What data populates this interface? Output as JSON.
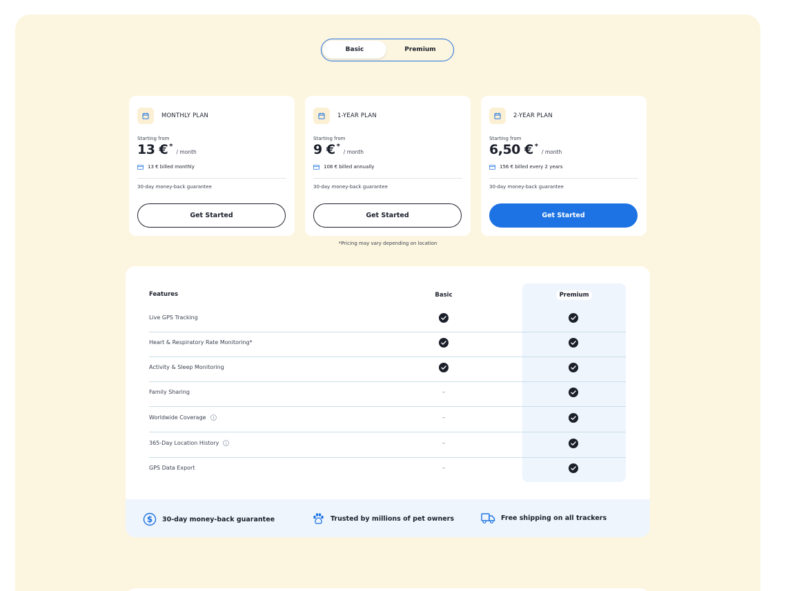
{
  "toggle": {
    "options": [
      "Basic",
      "Premium"
    ],
    "selected": "Basic"
  },
  "plans": [
    {
      "name": "MONTHLY PLAN",
      "starting_label": "Starting from",
      "price": "13 €",
      "star": "*",
      "per": "/ month",
      "billed": "13 € billed monthly",
      "guarantee": "30-day money-back guarantee",
      "cta": "Get Started",
      "primary": false
    },
    {
      "name": "1-YEAR PLAN",
      "starting_label": "Starting from",
      "price": "9 €",
      "star": "*",
      "per": "/ month",
      "billed": "108 € billed annually",
      "guarantee": "30-day money-back guarantee",
      "cta": "Get Started",
      "primary": false
    },
    {
      "name": "2-YEAR PLAN",
      "starting_label": "Starting from",
      "price": "6,50 €",
      "star": "*",
      "per": "/ month",
      "billed": "156 € billed every 2 years",
      "guarantee": "30-day money-back guarantee",
      "cta": "Get Started",
      "primary": true
    }
  ],
  "pricing_note": "*Pricing may vary depending on location",
  "features_table": {
    "headers": {
      "feature": "Features",
      "basic": "Basic",
      "premium": "Premium"
    },
    "rows": [
      {
        "name": "Live GPS Tracking",
        "info": false,
        "basic": true,
        "premium": true
      },
      {
        "name": "Heart & Respiratory Rate Monitoring*",
        "info": false,
        "basic": true,
        "premium": true
      },
      {
        "name": "Activity & Sleep Monitoring",
        "info": false,
        "basic": true,
        "premium": true
      },
      {
        "name": "Family Sharing",
        "info": false,
        "basic": false,
        "premium": true
      },
      {
        "name": "Worldwide Coverage",
        "info": true,
        "basic": false,
        "premium": true
      },
      {
        "name": "365-Day Location History",
        "info": true,
        "basic": false,
        "premium": true
      },
      {
        "name": "GPS Data Export",
        "info": false,
        "basic": false,
        "premium": true
      }
    ],
    "dash": "–"
  },
  "benefits": [
    {
      "icon": "dollar-circle-icon",
      "label": "30-day money-back guarantee"
    },
    {
      "icon": "paw-icon",
      "label": "Trusted by millions of pet owners"
    },
    {
      "icon": "truck-icon",
      "label": "Free shipping on all trackers"
    }
  ],
  "colors": {
    "panel": "#fcf5df",
    "accent": "#1d73e3",
    "premium_col": "#eef5fd",
    "check": "#1b1f2a"
  }
}
